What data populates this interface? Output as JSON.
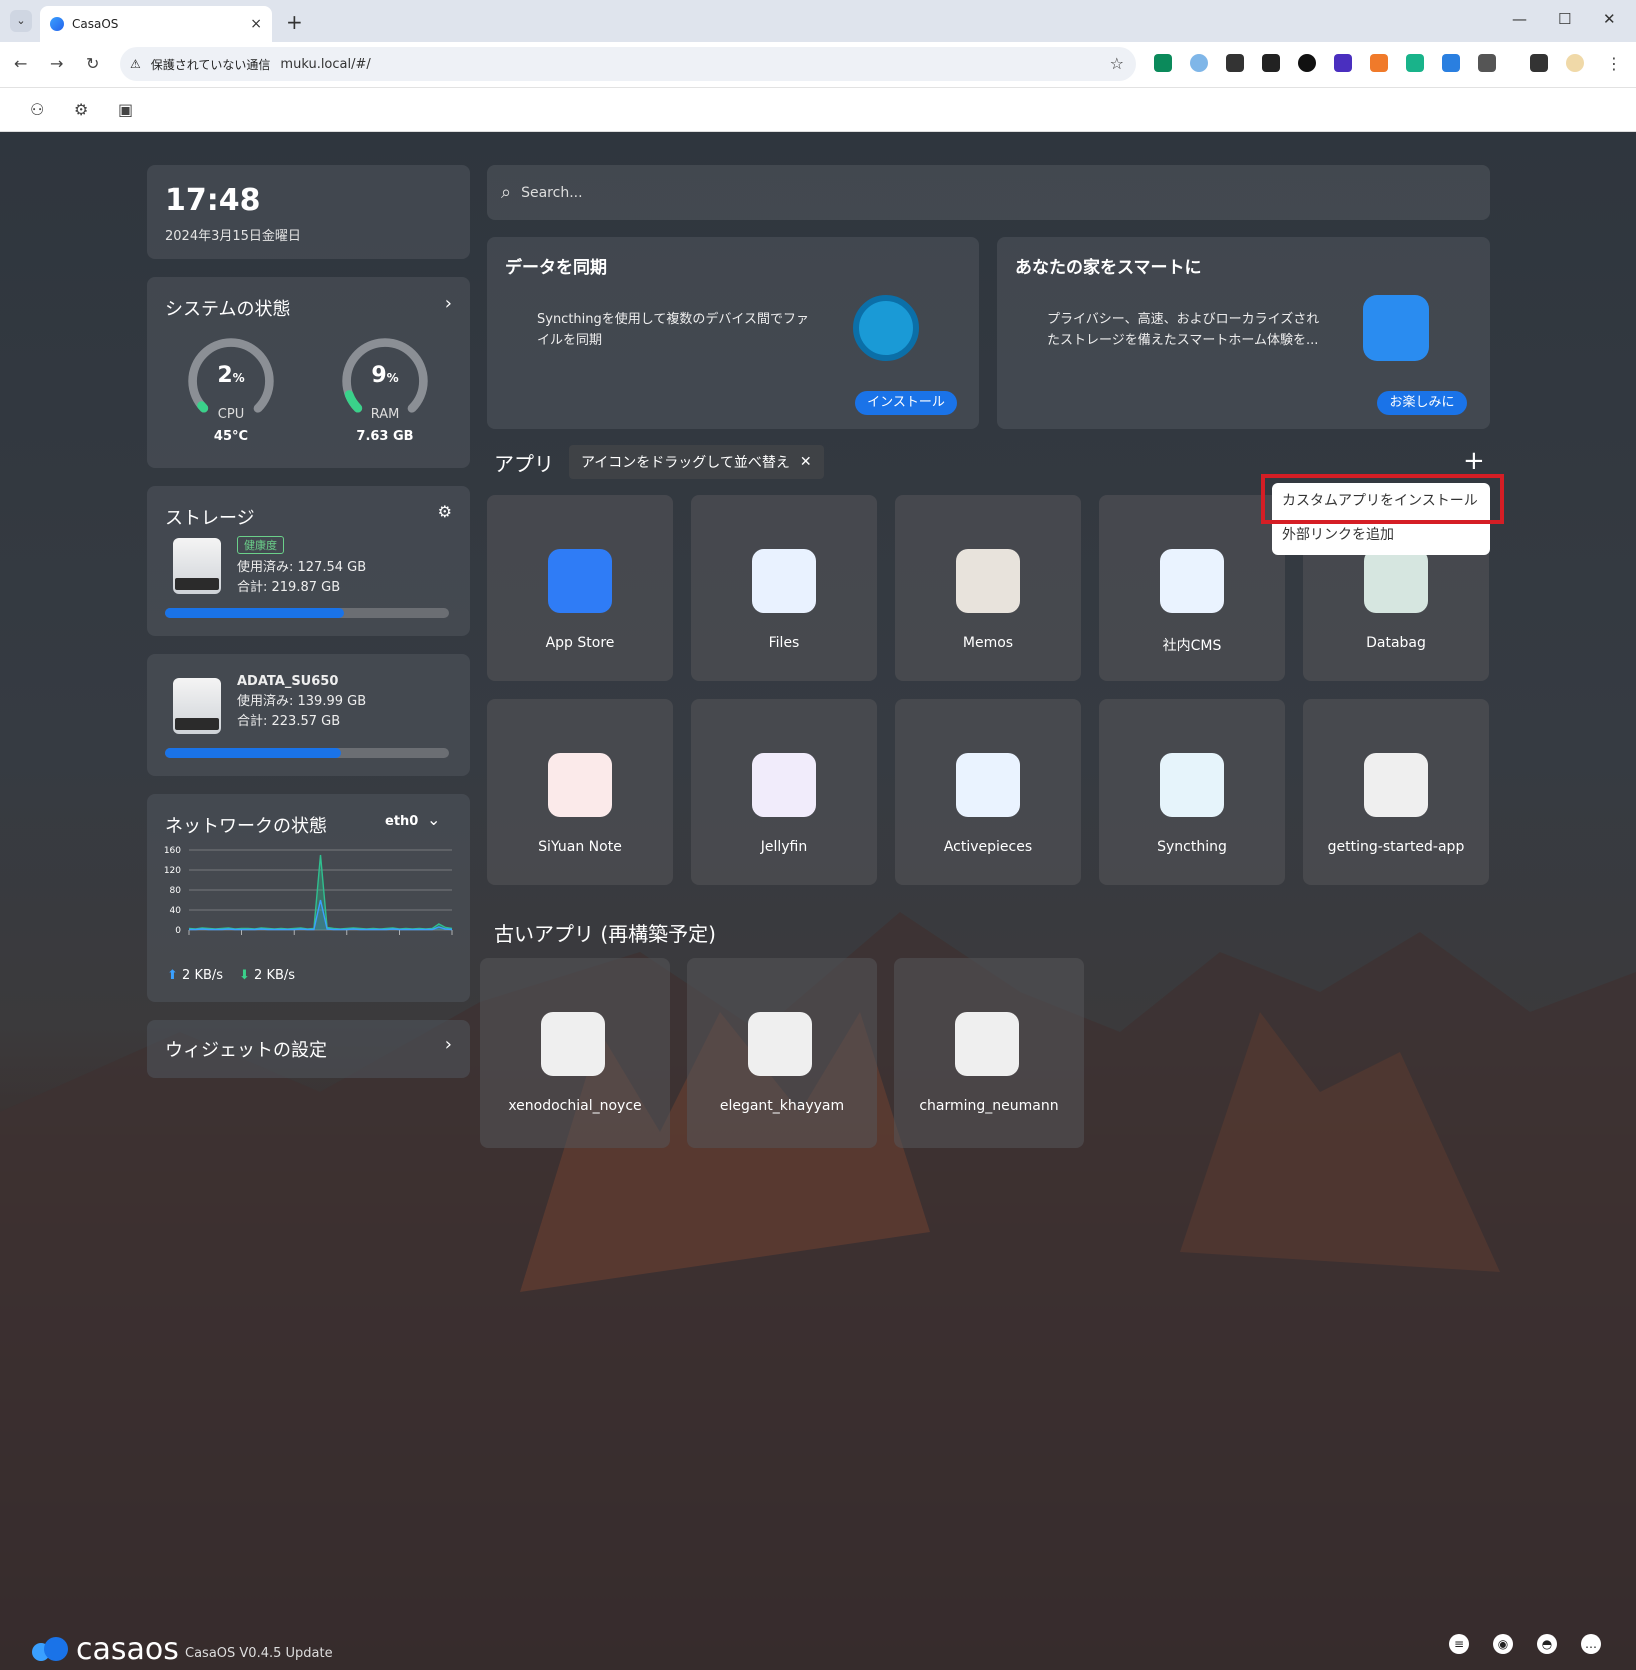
{
  "browser": {
    "tab_title": "CasaOS",
    "tab_close": "×",
    "new_tab": "+",
    "security_label": "保護されていない通信",
    "url": "muku.local/#/"
  },
  "clock": {
    "time": "17:48",
    "date": "2024年3月15日金曜日"
  },
  "system": {
    "title": "システムの状態",
    "cpu": {
      "percent": 2,
      "value": "2",
      "unit": "%",
      "label": "CPU",
      "temp": "45°C"
    },
    "ram": {
      "percent": 9,
      "value": "9",
      "unit": "%",
      "label": "RAM",
      "total": "7.63 GB"
    }
  },
  "storage": {
    "title": "ストレージ",
    "disks": [
      {
        "badge": "健康度",
        "used": "使用済み: 127.54 GB",
        "total": "合計: 219.87 GB",
        "fill": 0.63
      },
      {
        "name": "ADATA_SU650",
        "used": "使用済み: 139.99 GB",
        "total": "合計: 223.57 GB",
        "fill": 0.62
      }
    ]
  },
  "network": {
    "title": "ネットワークの状態",
    "interface": "eth0",
    "up": "2 KB/s",
    "down": "2 KB/s"
  },
  "chart_data": {
    "type": "line",
    "title": "",
    "xlabel": "",
    "ylabel": "",
    "ylim": [
      0,
      160
    ],
    "yticks": [
      "160",
      "120",
      "80",
      "40",
      "0"
    ],
    "x": [
      0,
      1,
      2,
      3,
      4,
      5,
      6,
      7,
      8,
      9,
      10,
      11,
      12,
      13,
      14,
      15,
      16,
      17,
      18,
      19,
      20,
      21,
      22,
      23,
      24,
      25,
      26,
      27,
      28,
      29,
      30,
      31,
      32,
      33,
      34,
      35,
      36,
      37,
      38,
      39,
      40
    ],
    "series": [
      {
        "values": [
          3,
          2,
          4,
          3,
          2,
          3,
          4,
          2,
          3,
          3,
          2,
          4,
          3,
          2,
          3,
          2,
          3,
          4,
          2,
          3,
          150,
          5,
          3,
          2,
          3,
          4,
          3,
          2,
          3,
          2,
          3,
          4,
          2,
          3,
          2,
          3,
          2,
          3,
          12,
          5,
          3
        ]
      },
      {
        "values": [
          1,
          1,
          2,
          1,
          1,
          1,
          2,
          1,
          1,
          1,
          1,
          2,
          1,
          1,
          1,
          1,
          1,
          2,
          1,
          1,
          60,
          2,
          1,
          1,
          1,
          2,
          1,
          1,
          1,
          1,
          1,
          2,
          1,
          1,
          1,
          1,
          1,
          1,
          6,
          2,
          1
        ]
      }
    ]
  },
  "widget_settings": {
    "label": "ウィジェットの設定"
  },
  "search": {
    "placeholder": "Search..."
  },
  "promos": [
    {
      "title": "データを同期",
      "text_line1": "Syncthingを使用して複数のデバイス間でファ",
      "text_line2": "イルを同期",
      "button": "インストール"
    },
    {
      "title": "あなたの家をスマートに",
      "text_line1": "プライバシー、高速、およびローカライズされ",
      "text_line2": "たストレージを備えたスマートホーム体験を...",
      "button": "お楽しみに"
    }
  ],
  "apps_section": {
    "title": "アプリ",
    "hint": "アイコンをドラッグして並べ替え",
    "hint_close": "✕",
    "plus": "+"
  },
  "context_menu": {
    "install_custom": "カスタムアプリをインストール",
    "add_link": "外部リンクを追加"
  },
  "apps": [
    {
      "label": "App Store",
      "icon": "app-store-icon"
    },
    {
      "label": "Files",
      "icon": "folder-icon"
    },
    {
      "label": "Memos",
      "icon": "memos-icon"
    },
    {
      "label": "社内CMS",
      "icon": "cube-icon"
    },
    {
      "label": "Databag",
      "icon": "databag-icon"
    },
    {
      "label": "SiYuan Note",
      "icon": "siyuan-icon"
    },
    {
      "label": "Jellyfin",
      "icon": "jellyfin-icon"
    },
    {
      "label": "Activepieces",
      "icon": "cube-icon"
    },
    {
      "label": "Syncthing",
      "icon": "syncthing-icon"
    },
    {
      "label": "getting-started-app",
      "icon": "gray-cube-icon"
    }
  ],
  "legacy_section": {
    "title": "古いアプリ (再構築予定)"
  },
  "legacy_apps": [
    {
      "label": "xenodochial_noyce"
    },
    {
      "label": "elegant_khayyam"
    },
    {
      "label": "charming_neumann"
    }
  ],
  "footer": {
    "brand": "casaos",
    "version": "CasaOS V0.4.5 Update"
  },
  "colors": {
    "accent": "#1a73e8",
    "highlight": "#d51e25",
    "chart": "#2fbf8f"
  }
}
